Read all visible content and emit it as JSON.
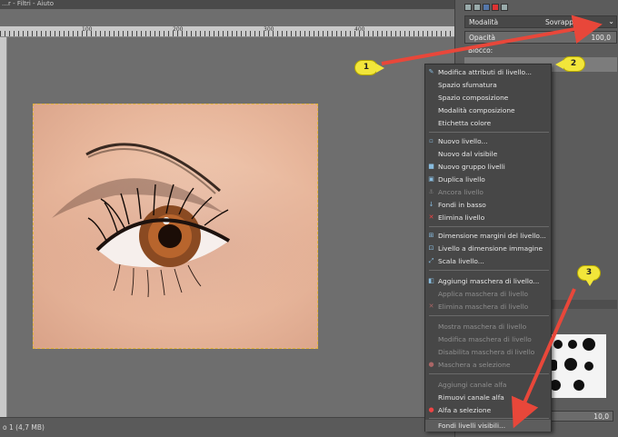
{
  "app": {
    "top_title": "…r - Filtri - Aiuto",
    "status_text": "o 1 (4,7 MB)"
  },
  "ruler": {
    "marks": [
      "100",
      "200",
      "300",
      "400"
    ]
  },
  "layers_panel": {
    "mode_label": "Modalità",
    "mode_value": "Sovrapposto",
    "opacity_label": "Opacità",
    "opacity_value": "100,0",
    "lock_label": "Blocco:"
  },
  "brush_size": "10,0",
  "context_menu": {
    "items": [
      {
        "label": "Modifica attributi di livello...",
        "icon": "edit-icon",
        "enabled": true
      },
      {
        "label": "Spazio sfumatura",
        "icon": "",
        "enabled": true
      },
      {
        "label": "Spazio composizione",
        "icon": "",
        "enabled": true
      },
      {
        "label": "Modalità composizione",
        "icon": "",
        "enabled": true
      },
      {
        "label": "Etichetta colore",
        "icon": "",
        "enabled": true
      },
      {
        "label": "Nuovo livello...",
        "icon": "new-layer-icon",
        "enabled": true
      },
      {
        "label": "Nuovo dal visibile",
        "icon": "",
        "enabled": true
      },
      {
        "label": "Nuovo gruppo livelli",
        "icon": "folder-icon",
        "enabled": true
      },
      {
        "label": "Duplica livello",
        "icon": "duplicate-icon",
        "enabled": true
      },
      {
        "label": "Ancora livello",
        "icon": "anchor-icon",
        "enabled": false
      },
      {
        "label": "Fondi in basso",
        "icon": "merge-down-icon",
        "enabled": true
      },
      {
        "label": "Elimina livello",
        "icon": "delete-icon",
        "enabled": true
      },
      {
        "label": "Dimensione margini del livello...",
        "icon": "resize-icon",
        "enabled": true
      },
      {
        "label": "Livello a dimensione immagine",
        "icon": "fit-icon",
        "enabled": true
      },
      {
        "label": "Scala livello...",
        "icon": "scale-icon",
        "enabled": true
      },
      {
        "label": "Aggiungi maschera di livello...",
        "icon": "mask-icon",
        "enabled": true
      },
      {
        "label": "Applica maschera di livello",
        "icon": "",
        "enabled": false
      },
      {
        "label": "Elimina maschera di livello",
        "icon": "delete-icon",
        "enabled": false
      },
      {
        "label": "Mostra maschera di livello",
        "icon": "",
        "enabled": false
      },
      {
        "label": "Modifica maschera di livello",
        "icon": "",
        "enabled": false
      },
      {
        "label": "Disabilita maschera di livello",
        "icon": "",
        "enabled": false
      },
      {
        "label": "Maschera a selezione",
        "icon": "selection-icon",
        "enabled": false
      },
      {
        "label": "Aggiungi canale alfa",
        "icon": "",
        "enabled": false
      },
      {
        "label": "Rimuovi canale alfa",
        "icon": "",
        "enabled": true
      },
      {
        "label": "Alfa a selezione",
        "icon": "alpha-icon",
        "enabled": true
      },
      {
        "label": "Fondi livelli visibili...",
        "icon": "",
        "enabled": true
      }
    ]
  },
  "callouts": [
    "1",
    "2",
    "3"
  ],
  "colors": {
    "callout": "#f2e63a",
    "arrow": "#e8473a",
    "menu_bg": "#474747",
    "canvas_bg": "#6e6e6e"
  }
}
